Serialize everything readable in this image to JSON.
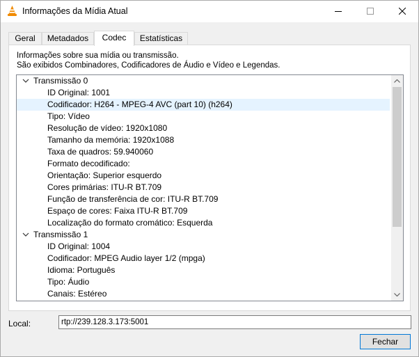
{
  "window": {
    "title": "Informações da Mídia Atual"
  },
  "tabs": [
    {
      "label": "Geral",
      "active": false
    },
    {
      "label": "Metadados",
      "active": false
    },
    {
      "label": "Codec",
      "active": true
    },
    {
      "label": "Estatísticas",
      "active": false
    }
  ],
  "info": {
    "line1": "Informações sobre sua mídia ou transmissão.",
    "line2": "São exibidos Combinadores, Codificadores de Áudio e Vídeo e Legendas."
  },
  "tree": {
    "streams": [
      {
        "label": "Transmissão 0",
        "expanded": true,
        "items": [
          "ID Original: 1001",
          "Codificador: H264 - MPEG-4 AVC (part 10) (h264)",
          "Tipo: Vídeo",
          "Resolução de vídeo: 1920x1080",
          "Tamanho da memória: 1920x1088",
          "Taxa de quadros: 59.940060",
          "Formato decodificado:",
          "Orientação: Superior esquerdo",
          "Cores primárias: ITU-R BT.709",
          "Função de transferência de cor: ITU-R BT.709",
          "Espaço de cores: Faixa ITU-R BT.709",
          "Localização do formato cromático: Esquerda"
        ]
      },
      {
        "label": "Transmissão 1",
        "expanded": true,
        "items": [
          "ID Original: 1004",
          "Codificador: MPEG Audio layer 1/2 (mpga)",
          "Idioma: Português",
          "Tipo: Áudio",
          "Canais: Estéreo"
        ]
      }
    ],
    "selected_item": "Codificador: H264 - MPEG-4 AVC (part 10) (h264)"
  },
  "location": {
    "label": "Local:",
    "value": "rtp://239.128.3.173:5001"
  },
  "buttons": {
    "close_label": "Fechar"
  },
  "colors": {
    "selection_bg": "#e5f3ff",
    "button_border": "#0078d7",
    "vlc_orange": "#f08a00"
  }
}
